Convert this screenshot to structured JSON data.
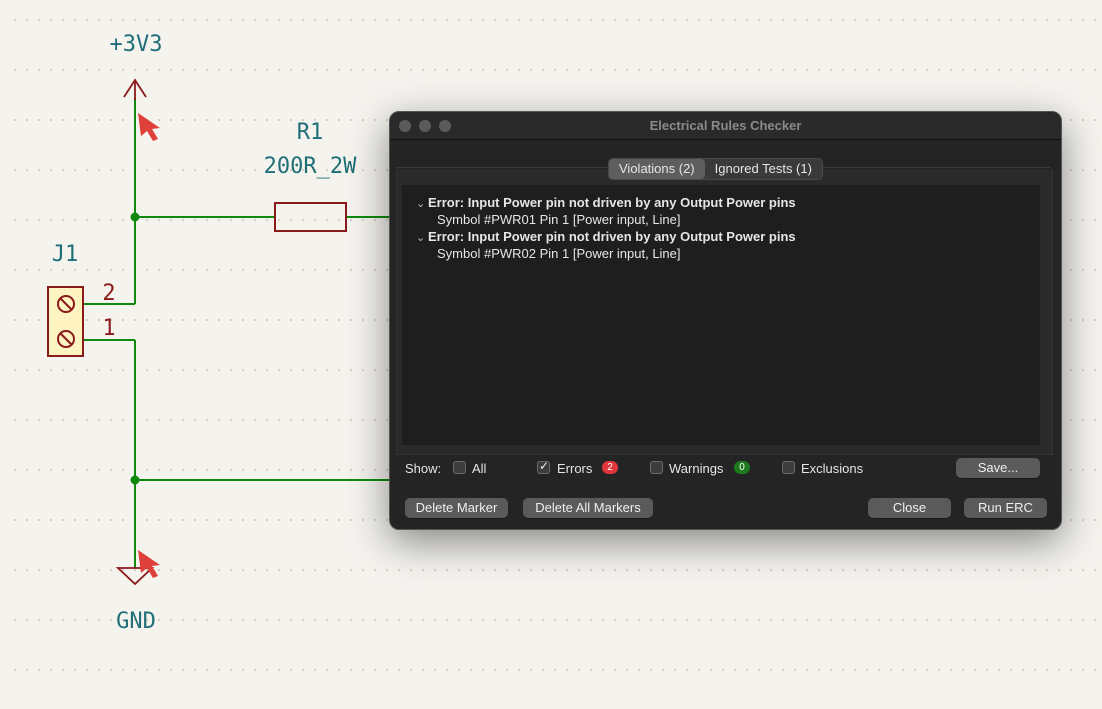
{
  "schematic": {
    "power_top_label": "+3V3",
    "power_bottom_label": "GND",
    "resistor_ref": "R1",
    "resistor_value": "200R_2W",
    "connector_ref": "J1",
    "pin2_label": "2",
    "pin1_label": "1",
    "wire_color": "#0f8a0f",
    "symbol_color": "#8b1a1a",
    "power_color": "#1f6e78",
    "marker_color": "#e0403a"
  },
  "dialog": {
    "title": "Electrical Rules Checker",
    "tabs": [
      {
        "label": "Violations (2)",
        "active": true
      },
      {
        "label": "Ignored Tests (1)",
        "active": false
      }
    ],
    "violations": [
      {
        "title": "Error: Input Power pin not driven by any Output Power pins",
        "detail": "Symbol #PWR01 Pin 1 [Power input, Line]"
      },
      {
        "title": "Error: Input Power pin not driven by any Output Power pins",
        "detail": "Symbol #PWR02 Pin 1 [Power input, Line]"
      }
    ],
    "show": {
      "label": "Show:",
      "all_label": "All",
      "errors_label": "Errors",
      "errors_count": "2",
      "errors_badge_color": "#e0353b",
      "warnings_label": "Warnings",
      "warnings_count": "0",
      "warnings_badge_color": "#1e7a1e",
      "exclusions_label": "Exclusions",
      "save_label": "Save..."
    },
    "buttons": {
      "delete_marker": "Delete Marker",
      "delete_all_markers": "Delete All Markers",
      "close": "Close",
      "run_erc": "Run ERC"
    }
  }
}
